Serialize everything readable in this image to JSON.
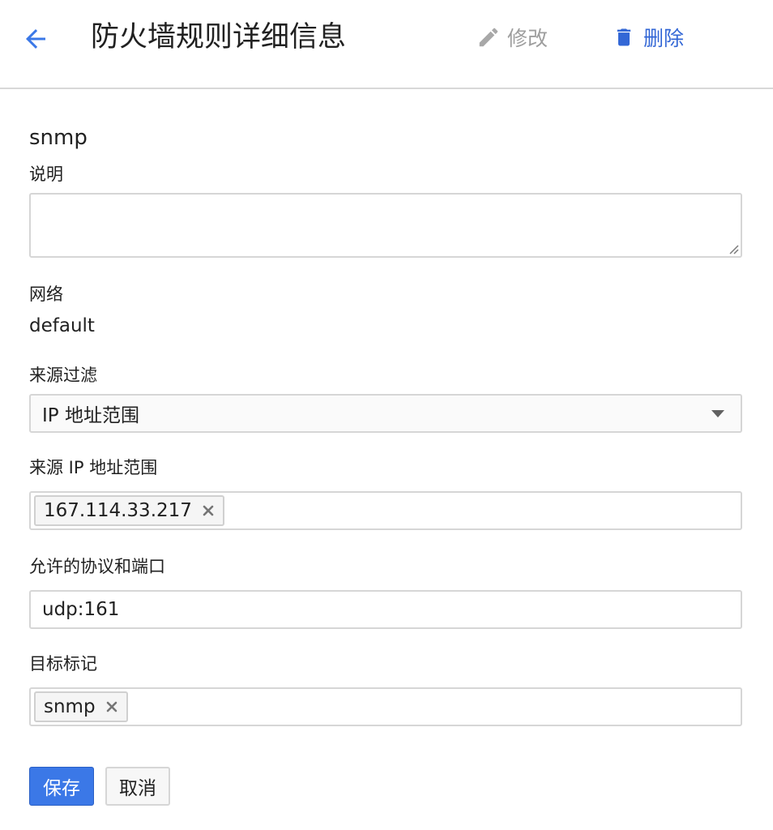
{
  "header": {
    "title": "防火墙规则详细信息",
    "edit_label": "修改",
    "delete_label": "删除"
  },
  "rule": {
    "name": "snmp",
    "description_label": "说明",
    "description_value": "",
    "network_label": "网络",
    "network_value": "default",
    "source_filter_label": "来源过滤",
    "source_filter_value": "IP 地址范围",
    "source_ip_label": "来源 IP 地址范围",
    "source_ip_chips": [
      "167.114.33.217"
    ],
    "protocols_label": "允许的协议和端口",
    "protocols_value": "udp:161",
    "target_tags_label": "目标标记",
    "target_tags_chips": [
      "snmp"
    ]
  },
  "actions": {
    "save_label": "保存",
    "cancel_label": "取消"
  },
  "colors": {
    "accent": "#3367d6",
    "primary_button": "#3b78e7",
    "disabled_text": "#9e9e9e"
  },
  "icons": {
    "back": "arrow-left-icon",
    "edit": "pencil-icon",
    "delete": "trash-icon",
    "remove": "close-icon",
    "dropdown": "triangle-down-icon"
  }
}
